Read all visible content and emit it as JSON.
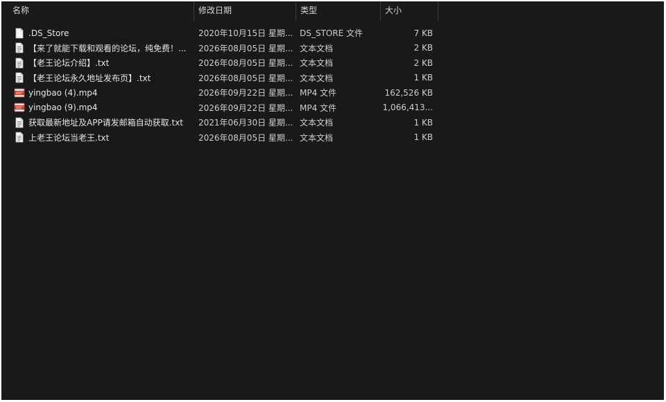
{
  "columns": {
    "name": "名称",
    "date": "修改日期",
    "type": "类型",
    "size": "大小"
  },
  "sort_indicator": "^",
  "files": [
    {
      "name": ".DS_Store",
      "date": "2020年10月15日 星期...",
      "type": "DS_STORE 文件",
      "size": "7 KB",
      "icon": "document-icon"
    },
    {
      "name": "【来了就能下载和观看的论坛，纯免费！...",
      "date": "2026年08月05日 星期...",
      "type": "文本文档",
      "size": "2 KB",
      "icon": "text-file-icon"
    },
    {
      "name": "【老王论坛介绍】.txt",
      "date": "2026年08月05日 星期...",
      "type": "文本文档",
      "size": "2 KB",
      "icon": "text-file-icon"
    },
    {
      "name": "【老王论坛永久地址发布页】.txt",
      "date": "2026年08月05日 星期...",
      "type": "文本文档",
      "size": "1 KB",
      "icon": "text-file-icon"
    },
    {
      "name": "yingbao (4).mp4",
      "date": "2026年09月22日 星期...",
      "type": "MP4 文件",
      "size": "162,526 KB",
      "icon": "video-file-icon"
    },
    {
      "name": "yingbao (9).mp4",
      "date": "2026年09月22日 星期...",
      "type": "MP4 文件",
      "size": "1,066,413...",
      "icon": "video-file-icon"
    },
    {
      "name": "获取最新地址及APP请发邮箱自动获取.txt",
      "date": "2021年06月30日 星期...",
      "type": "文本文档",
      "size": "1 KB",
      "icon": "text-file-icon"
    },
    {
      "name": "上老王论坛当老王.txt",
      "date": "2026年08月05日 星期...",
      "type": "文本文档",
      "size": "1 KB",
      "icon": "text-file-icon"
    }
  ],
  "colors": {
    "background": "#191919",
    "text": "#e0e0e0",
    "video_icon": "#c0392b"
  }
}
